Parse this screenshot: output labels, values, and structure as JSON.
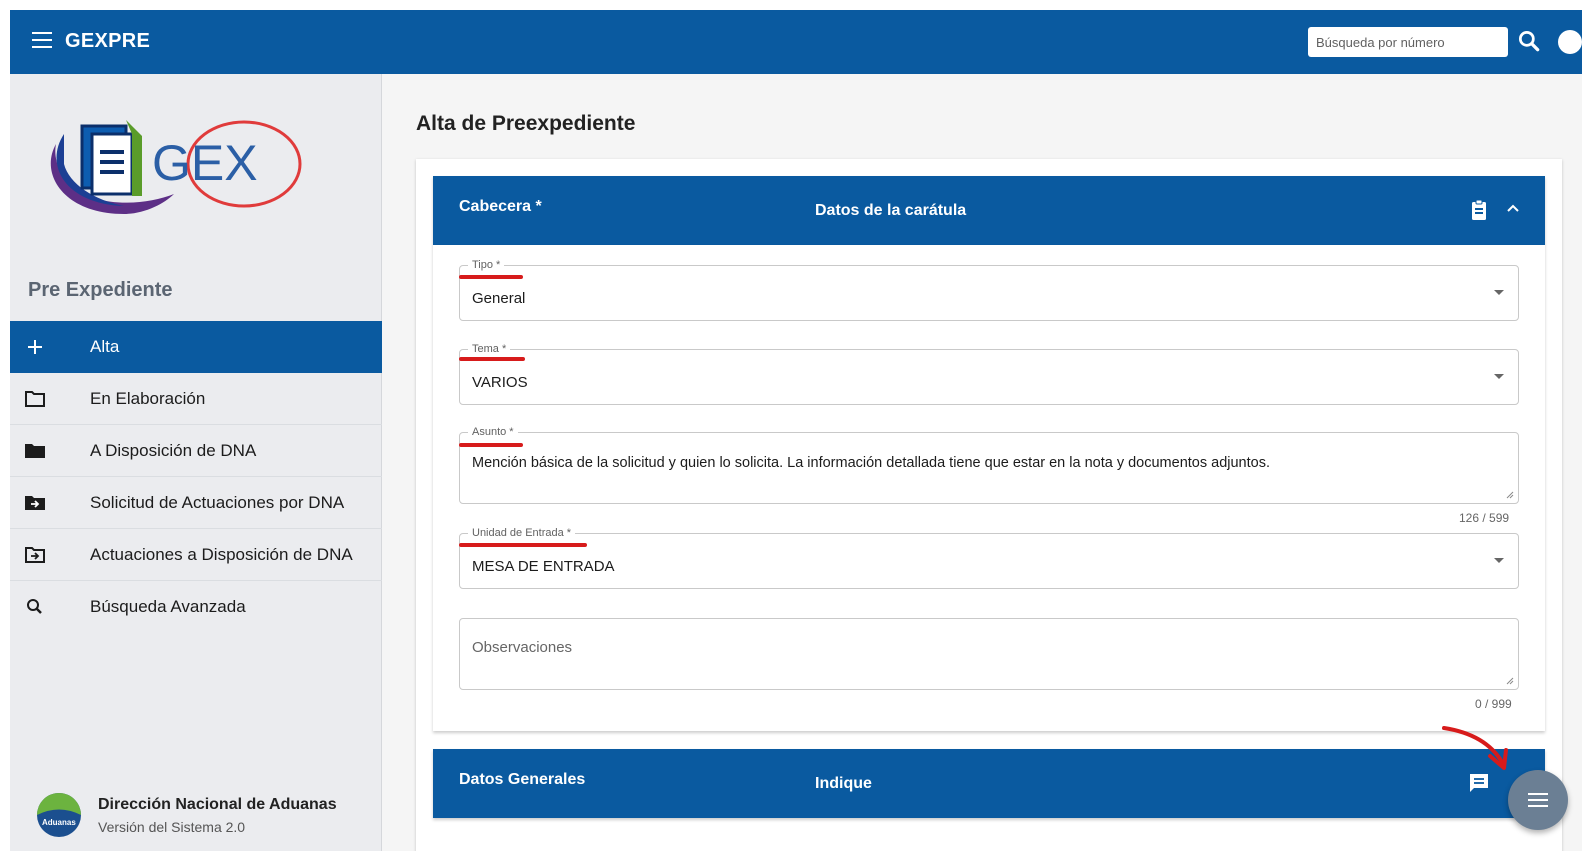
{
  "app": {
    "title": "GEXPRE"
  },
  "search": {
    "placeholder": "Búsqueda por número"
  },
  "sidebar": {
    "logo_text": "GEX",
    "section_title": "Pre Expediente",
    "items": [
      {
        "label": "Alta",
        "icon": "plus-icon"
      },
      {
        "label": "En Elaboración",
        "icon": "folder-outline-icon"
      },
      {
        "label": "A Disposición de DNA",
        "icon": "folder-icon"
      },
      {
        "label": "Solicitud de Actuaciones por DNA",
        "icon": "folder-move-icon"
      },
      {
        "label": "Actuaciones a Disposición de DNA",
        "icon": "folder-move-outline-icon"
      },
      {
        "label": "Búsqueda Avanzada",
        "icon": "search-icon"
      }
    ],
    "footer": {
      "org_name": "Dirección Nacional de Aduanas",
      "version": "Versión del Sistema 2.0",
      "org_logo_text": "Aduanas"
    }
  },
  "main": {
    "page_title": "Alta de Preexpediente",
    "header_panel": {
      "title": "Cabecera *",
      "description": "Datos de la carátula"
    },
    "fields": {
      "tipo": {
        "label": "Tipo *",
        "value": "General"
      },
      "tema": {
        "label": "Tema *",
        "value": "VARIOS"
      },
      "asunto": {
        "label": "Asunto *",
        "value": "Mención básica de la solicitud y quien lo solicita. La información detallada tiene que estar en la nota y documentos adjuntos.",
        "counter": "126 / 599"
      },
      "unidad": {
        "label": "Unidad de Entrada *",
        "value": "MESA DE ENTRADA"
      },
      "observaciones": {
        "placeholder": "Observaciones",
        "counter": "0 / 999"
      }
    },
    "general_panel": {
      "title": "Datos Generales",
      "description": "Indique"
    }
  },
  "colors": {
    "primary": "#0a5aa0",
    "annotation": "#d71b1b",
    "fab": "#6b7f94",
    "sidebar_bg": "#ebecef"
  }
}
